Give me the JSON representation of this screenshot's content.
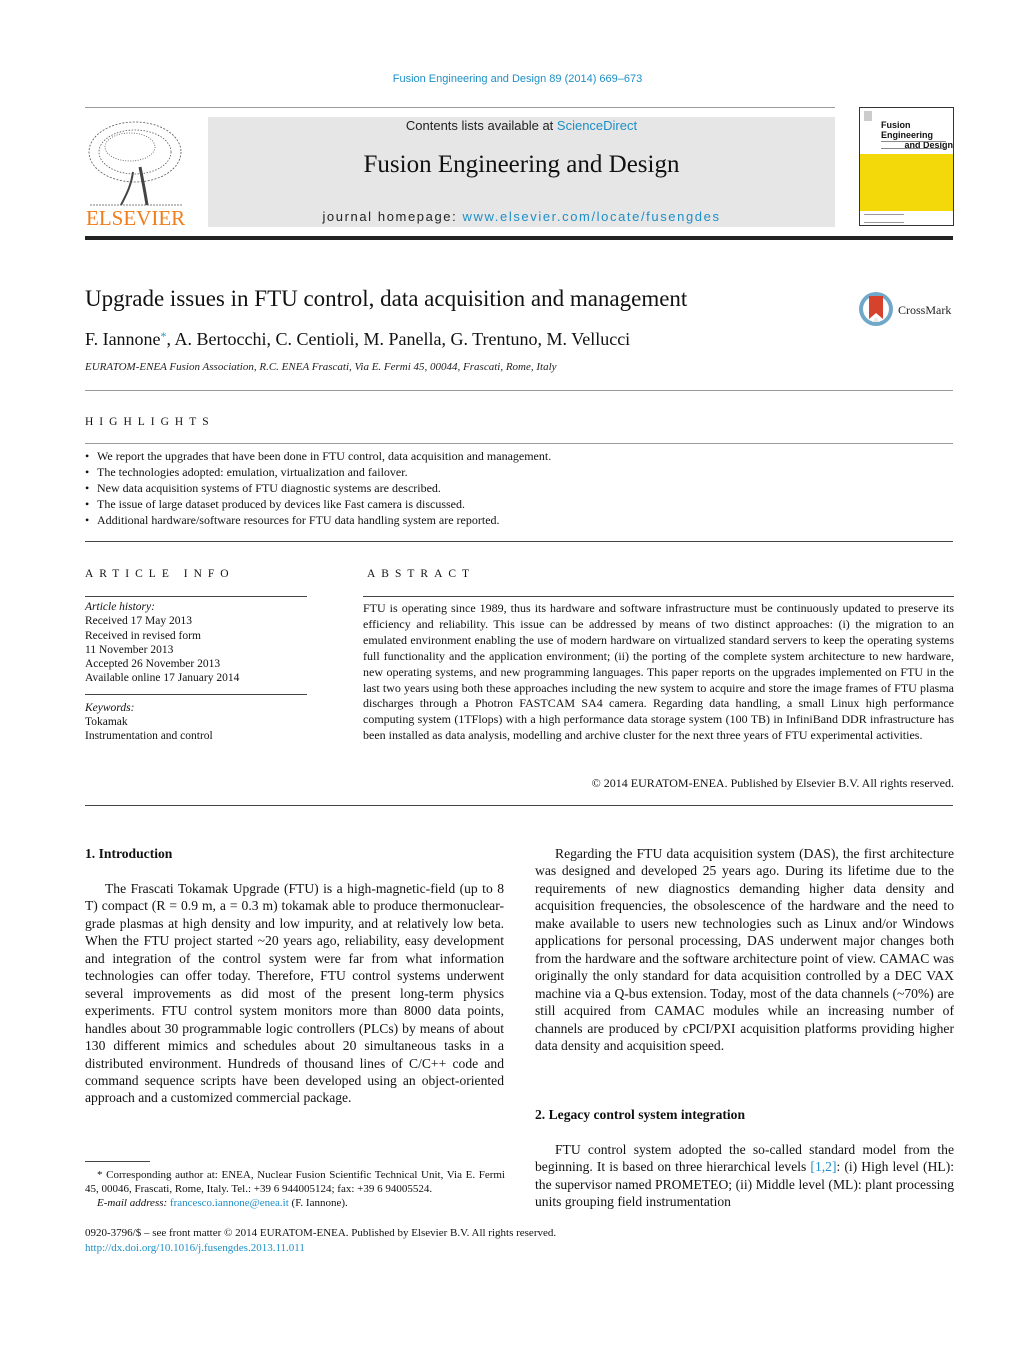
{
  "header": {
    "journal_ref": "Fusion Engineering and Design 89 (2014) 669–673",
    "publisher_logo_text": "ELSEVIER",
    "contents_prefix": "Contents lists available at ",
    "contents_link": "ScienceDirect",
    "journal_title": "Fusion Engineering and Design",
    "homepage_prefix": "journal homepage: ",
    "homepage_link": "www.elsevier.com/locate/fusengdes",
    "cover_title_line1": "Fusion Engineering",
    "cover_title_line2": "and Design",
    "colors": {
      "link": "#1e8fc6",
      "elsevier_orange": "#f07d1b",
      "cover_yellow": "#f4d90a",
      "masthead_bg": "#e6e6e6"
    }
  },
  "article": {
    "title": "Upgrade issues in FTU control, data acquisition and management",
    "crossmark_label": "CrossMark",
    "authors": [
      {
        "name": "F. Iannone",
        "marker": "*"
      },
      {
        "name": ", A. Bertocchi, C. Centioli, M. Panella, G. Trentuno, M. Vellucci",
        "marker": ""
      }
    ],
    "affiliation": "EURATOM-ENEA Fusion Association, R.C. ENEA Frascati, Via E. Fermi 45, 00044, Frascati, Rome, Italy"
  },
  "highlights": {
    "heading": "HIGHLIGHTS",
    "items": [
      "We report the upgrades that have been done in FTU control, data acquisition and management.",
      "The technologies adopted: emulation, virtualization and failover.",
      "New data acquisition systems of FTU diagnostic systems are described.",
      "The issue of large dataset produced by devices like Fast camera is discussed.",
      "Additional hardware/software resources for FTU data handling system are reported."
    ]
  },
  "article_info": {
    "heading": "ARTICLE INFO",
    "history_label": "Article history:",
    "history": [
      "Received 17 May 2013",
      "Received in revised form",
      "11 November 2013",
      "Accepted 26 November 2013",
      "Available online 17 January 2014"
    ],
    "keywords_label": "Keywords:",
    "keywords": [
      "Tokamak",
      "Instrumentation and control"
    ]
  },
  "abstract": {
    "heading": "ABSTRACT",
    "text": "FTU is operating since 1989, thus its hardware and software infrastructure must be continuously updated to preserve its efficiency and reliability. This issue can be addressed by means of two distinct approaches: (i) the migration to an emulated environment enabling the use of modern hardware on virtualized standard servers to keep the operating systems full functionality and the application environment; (ii) the porting of the complete system architecture to new hardware, new operating systems, and new programming languages. This paper reports on the upgrades implemented on FTU in the last two years using both these approaches including the new system to acquire and store the image frames of FTU plasma discharges through a Photron FASTCAM SA4 camera. Regarding data handling, a small Linux high performance computing system (1TFlops) with a high performance data storage system (100 TB) in InfiniBand DDR infrastructure has been installed as data analysis, modelling and archive cluster for the next three years of FTU experimental activities.",
    "copyright": "© 2014 EURATOM-ENEA. Published by Elsevier B.V. All rights reserved."
  },
  "body": {
    "section1": {
      "heading": "1.  Introduction",
      "paragraph": "The Frascati Tokamak Upgrade (FTU) is a high-magnetic-field (up to 8 T) compact (R = 0.9 m, a = 0.3 m) tokamak able to produce thermonuclear-grade plasmas at high density and low impurity, and at relatively low beta. When the FTU project started ~20 years ago, reliability, easy development and integration of the control system were far from what information technologies can offer today. Therefore, FTU control systems underwent several improvements as did most of the present long-term physics experiments. FTU control system monitors more than 8000 data points, handles about 30 programmable logic controllers (PLCs) by means of about 130 different mimics and schedules about 20 simultaneous tasks in a distributed environment. Hundreds of thousand lines of C/C++ code and command sequence scripts have been developed using an object-oriented approach and a customized commercial package."
    },
    "right_paragraph": "Regarding the FTU data acquisition system (DAS), the first architecture was designed and developed 25 years ago. During its lifetime due to the requirements of new diagnostics demanding higher data density and acquisition frequencies, the obsolescence of the hardware and the need to make available to users new technologies such as Linux and/or Windows applications for personal processing, DAS underwent major changes both from the hardware and the software architecture point of view. CAMAC was originally the only standard for data acquisition controlled by a DEC VAX machine via a Q-bus extension. Today, most of the data channels (~70%) are still acquired from CAMAC modules while an increasing number of channels are produced by cPCI/PXI acquisition platforms providing higher data density and acquisition speed.",
    "section2": {
      "heading": "2.  Legacy control system integration",
      "paragraph_before_ref": "FTU control system adopted the so-called standard model from the beginning. It is based on three hierarchical levels ",
      "ref": "[1,2]",
      "paragraph_after_ref": ": (i) High level (HL): the supervisor named PROMETEO; (ii) Middle level (ML): plant processing units grouping field instrumentation"
    }
  },
  "footnote": {
    "text": "* Corresponding author at: ENEA, Nuclear Fusion Scientific Technical Unit, Via E. Fermi 45, 00046, Frascati, Rome, Italy. Tel.: +39 6 944005124; fax: +39 6 94005524.",
    "email_label": "E-mail address: ",
    "email": "francesco.iannone@enea.it",
    "email_suffix": " (F. Iannone)."
  },
  "front_matter": {
    "issn_line": "0920-3796/$ – see front matter © 2014 EURATOM-ENEA. Published by Elsevier B.V. All rights reserved.",
    "doi": "http://dx.doi.org/10.1016/j.fusengdes.2013.11.011"
  }
}
